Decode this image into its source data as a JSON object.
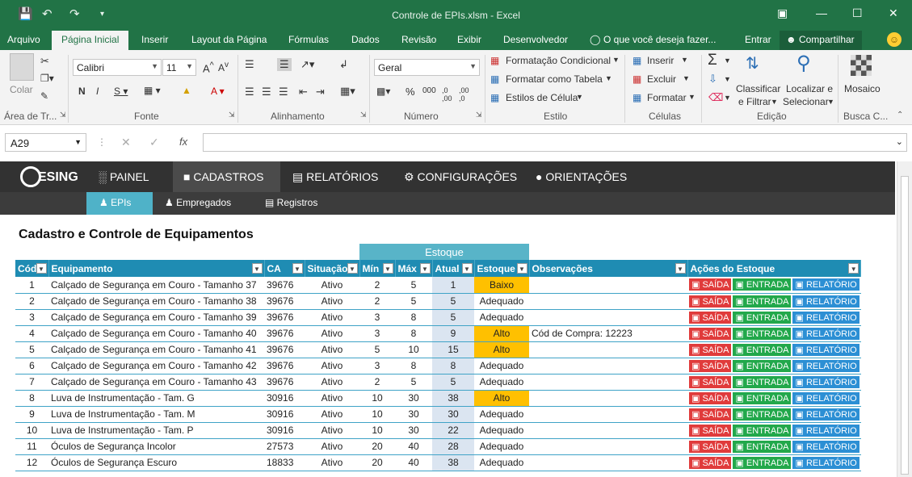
{
  "window": {
    "title": "Controle de EPIs.xlsm  -  Excel"
  },
  "menu": {
    "items": [
      "Arquivo",
      "Página Inicial",
      "Inserir",
      "Layout da Página",
      "Fórmulas",
      "Dados",
      "Revisão",
      "Exibir",
      "Desenvolvedor"
    ],
    "tell_me": "O que você deseja fazer...",
    "signin": "Entrar",
    "share": "Compartilhar"
  },
  "ribbon": {
    "paste": "Colar",
    "clipboard": "Área de Tr...",
    "font_name": "Calibri",
    "font_size": "11",
    "font_group": "Fonte",
    "align_group": "Alinhamento",
    "number_format": "Geral",
    "number_group": "Número",
    "cond_format": "Formatação Condicional",
    "format_table": "Formatar como Tabela",
    "cell_styles": "Estilos de Célula",
    "style_group": "Estilo",
    "insert": "Inserir",
    "delete": "Excluir",
    "format": "Formatar",
    "cells_group": "Células",
    "sort1": "Classificar",
    "sort2": "e Filtrar",
    "find1": "Localizar e",
    "find2": "Selecionar",
    "edit_group": "Edição",
    "mosaic": "Mosaico",
    "search_group": "Busca C..."
  },
  "formula": {
    "namebox": "A29",
    "fx": "fx",
    "value": ""
  },
  "app": {
    "logo": "ESING",
    "nav": [
      "PAINEL",
      "CADASTROS",
      "RELATÓRIOS",
      "CONFIGURAÇÕES",
      "ORIENTAÇÕES"
    ],
    "subnav": [
      "EPIs",
      "Empregados",
      "Registros"
    ],
    "heading": "Cadastro e Controle de Equipamentos",
    "estoque_header": "Estoque",
    "columns": [
      "Cód",
      "Equipamento",
      "CA",
      "Situação",
      "Mín",
      "Máx",
      "Atual",
      "Estoque",
      "Observações",
      "Ações do Estoque"
    ],
    "actions": [
      "SAÍDA",
      "ENTRADA",
      "RELATÓRIO"
    ],
    "rows": [
      [
        "1",
        "Calçado de Segurança em Couro - Tamanho 37",
        "39676",
        "Ativo",
        "2",
        "5",
        "1",
        "Baixo",
        ""
      ],
      [
        "2",
        "Calçado de Segurança em Couro - Tamanho 38",
        "39676",
        "Ativo",
        "2",
        "5",
        "5",
        "Adequado",
        ""
      ],
      [
        "3",
        "Calçado de Segurança em Couro - Tamanho 39",
        "39676",
        "Ativo",
        "3",
        "8",
        "5",
        "Adequado",
        ""
      ],
      [
        "4",
        "Calçado de Segurança em Couro - Tamanho 40",
        "39676",
        "Ativo",
        "3",
        "8",
        "9",
        "Alto",
        "Cód de Compra: 12223"
      ],
      [
        "5",
        "Calçado de Segurança em Couro - Tamanho 41",
        "39676",
        "Ativo",
        "5",
        "10",
        "15",
        "Alto",
        ""
      ],
      [
        "6",
        "Calçado de Segurança em Couro - Tamanho 42",
        "39676",
        "Ativo",
        "3",
        "8",
        "8",
        "Adequado",
        ""
      ],
      [
        "7",
        "Calçado de Segurança em Couro - Tamanho 43",
        "39676",
        "Ativo",
        "2",
        "5",
        "5",
        "Adequado",
        ""
      ],
      [
        "8",
        "Luva de Instrumentação - Tam. G",
        "30916",
        "Ativo",
        "10",
        "30",
        "38",
        "Alto",
        ""
      ],
      [
        "9",
        "Luva de Instrumentação - Tam. M",
        "30916",
        "Ativo",
        "10",
        "30",
        "30",
        "Adequado",
        ""
      ],
      [
        "10",
        "Luva de Instrumentação - Tam. P",
        "30916",
        "Ativo",
        "10",
        "30",
        "22",
        "Adequado",
        ""
      ],
      [
        "11",
        "Óculos de Segurança Incolor",
        "27573",
        "Ativo",
        "20",
        "40",
        "28",
        "Adequado",
        ""
      ],
      [
        "12",
        "Óculos de Segurança Escuro",
        "18833",
        "Ativo",
        "20",
        "40",
        "38",
        "Adequado",
        ""
      ]
    ]
  },
  "colors": {
    "excel_green": "#217346",
    "table_header": "#1f8cb3",
    "alert": "#ffc000"
  }
}
